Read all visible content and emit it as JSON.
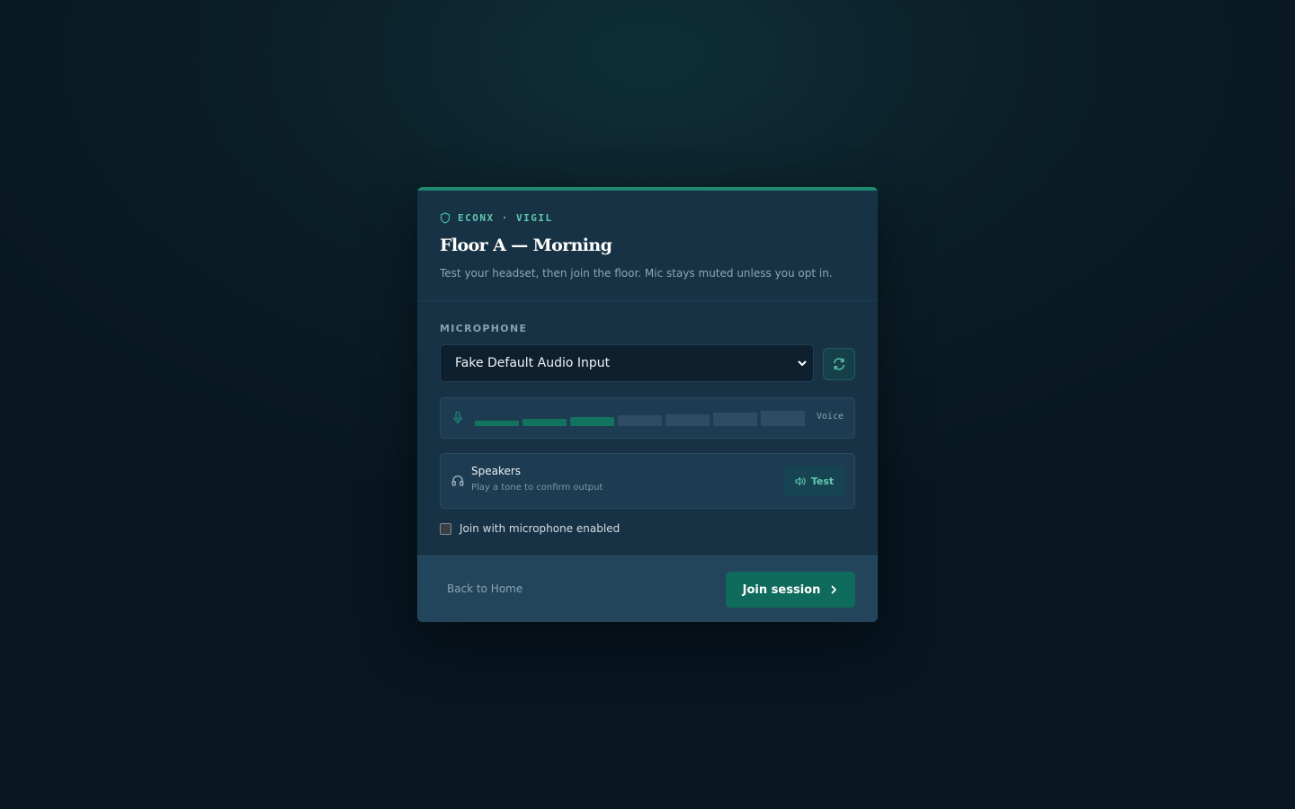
{
  "brand": {
    "label": "ECONX · VIGIL",
    "icon": "shield-icon"
  },
  "header": {
    "title": "Floor A — Morning",
    "subtitle": "Test your headset, then join the floor. Mic stays muted unless you opt in."
  },
  "microphone": {
    "section_label": "MICROPHONE",
    "selected_device": "Fake Default Audio Input",
    "refresh_icon": "refresh-icon",
    "level_meter": {
      "label": "Voice",
      "active_bars": 3,
      "total_bars": 7
    }
  },
  "speakers": {
    "title": "Speakers",
    "subtitle": "Play a tone to confirm output",
    "test_label": "Test",
    "icon": "headphones-icon"
  },
  "options": {
    "join_with_mic_label": "Join with microphone enabled",
    "join_with_mic_checked": false
  },
  "footer": {
    "back_label": "Back to Home",
    "join_label": "Join session"
  },
  "colors": {
    "accent": "#1e8a72",
    "accent_text": "#5fc6ad",
    "card": "#173245",
    "primary_button": "#0f6b5b"
  }
}
